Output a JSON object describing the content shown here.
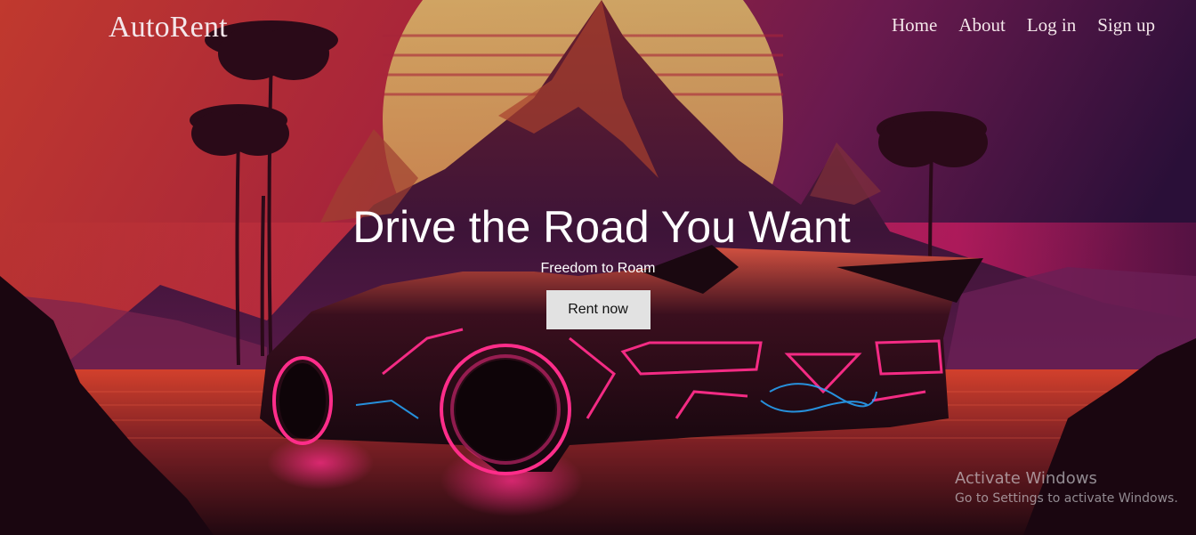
{
  "brand": "AutoRent",
  "nav": {
    "home": "Home",
    "about": "About",
    "login": "Log in",
    "signup": "Sign up"
  },
  "hero": {
    "title": "Drive the Road You Want",
    "subtitle": "Freedom to Roam",
    "cta_label": "Rent now"
  },
  "watermark": {
    "title": "Activate Windows",
    "subtitle": "Go to Settings to activate Windows."
  },
  "colors": {
    "nav_text": "#f4e6ea",
    "hero_text": "#ffffff",
    "cta_bg": "#e2e2e2",
    "neon_pink": "#ff2d8a",
    "neon_blue": "#27a8ff"
  }
}
